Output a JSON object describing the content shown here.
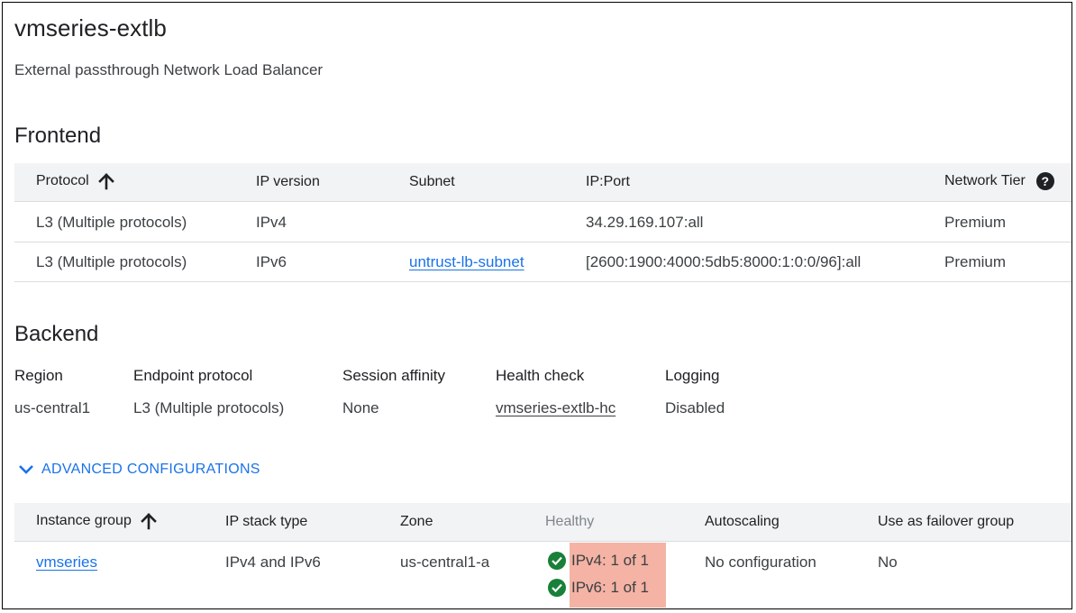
{
  "header": {
    "title": "vmseries-extlb",
    "subtitle": "External passthrough Network Load Balancer"
  },
  "frontend": {
    "section_title": "Frontend",
    "columns": [
      "Protocol",
      "IP version",
      "Subnet",
      "IP:Port",
      "Network Tier"
    ],
    "rows": [
      {
        "protocol": "L3 (Multiple protocols)",
        "ip_version": "IPv4",
        "subnet": "",
        "ip_port": "34.29.169.107:all",
        "tier": "Premium"
      },
      {
        "protocol": "L3 (Multiple protocols)",
        "ip_version": "IPv6",
        "subnet": "untrust-lb-subnet",
        "ip_port": "[2600:1900:4000:5db5:8000:1:0:0/96]:all",
        "tier": "Premium"
      }
    ]
  },
  "backend": {
    "section_title": "Backend",
    "fields": [
      {
        "label": "Region",
        "value": "us-central1"
      },
      {
        "label": "Endpoint protocol",
        "value": "L3 (Multiple protocols)"
      },
      {
        "label": "Session affinity",
        "value": "None"
      },
      {
        "label": "Health check",
        "value": "vmseries-extlb-hc"
      },
      {
        "label": "Logging",
        "value": "Disabled"
      }
    ]
  },
  "advanced": {
    "label": "ADVANCED CONFIGURATIONS",
    "columns": [
      "Instance group",
      "IP stack type",
      "Zone",
      "Healthy",
      "Autoscaling",
      "Use as failover group"
    ],
    "rows": [
      {
        "instance_group": "vmseries",
        "ip_stack_type": "IPv4 and IPv6",
        "zone": "us-central1-a",
        "healthy": [
          "IPv4: 1 of 1",
          "IPv6: 1 of 1"
        ],
        "autoscaling": "No configuration",
        "failover": "No"
      }
    ]
  },
  "colors": {
    "link": "#1a73e8",
    "healthy_check": "#188038",
    "highlight": "#f4b3a4"
  }
}
